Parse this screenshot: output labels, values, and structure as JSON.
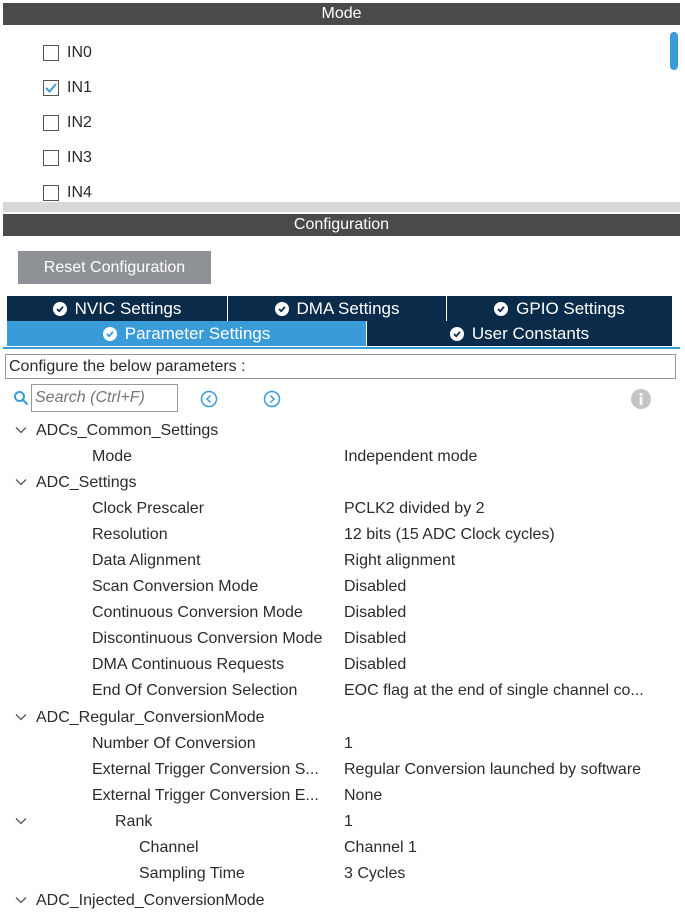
{
  "mode": {
    "header": "Mode",
    "items": [
      {
        "label": "IN0",
        "checked": false
      },
      {
        "label": "IN1",
        "checked": true
      },
      {
        "label": "IN2",
        "checked": false
      },
      {
        "label": "IN3",
        "checked": false
      },
      {
        "label": "IN4",
        "checked": false
      }
    ]
  },
  "configuration": {
    "header": "Configuration",
    "reset_label": "Reset Configuration",
    "tabs": [
      {
        "label": "NVIC Settings",
        "active": false
      },
      {
        "label": "DMA Settings",
        "active": false
      },
      {
        "label": "GPIO Settings",
        "active": false
      },
      {
        "label": "Parameter Settings",
        "active": true
      },
      {
        "label": "User Constants",
        "active": false
      }
    ],
    "configure_text": "Configure the below parameters :",
    "search_placeholder": "Search (Ctrl+F)"
  },
  "tree": {
    "groups": [
      {
        "name": "ADCs_Common_Settings",
        "params": [
          {
            "label": "Mode",
            "value": "Independent mode"
          }
        ]
      },
      {
        "name": "ADC_Settings",
        "params": [
          {
            "label": "Clock Prescaler",
            "value": "PCLK2 divided by 2"
          },
          {
            "label": "Resolution",
            "value": "12 bits (15 ADC Clock cycles)"
          },
          {
            "label": "Data Alignment",
            "value": "Right alignment"
          },
          {
            "label": "Scan Conversion Mode",
            "value": "Disabled"
          },
          {
            "label": "Continuous Conversion Mode",
            "value": "Disabled"
          },
          {
            "label": "Discontinuous Conversion Mode",
            "value": "Disabled"
          },
          {
            "label": "DMA Continuous Requests",
            "value": "Disabled"
          },
          {
            "label": "End Of Conversion Selection",
            "value": "EOC flag at the end of single channel co..."
          }
        ]
      },
      {
        "name": "ADC_Regular_ConversionMode",
        "params": [
          {
            "label": "Number Of Conversion",
            "value": "1"
          },
          {
            "label": "External Trigger Conversion S...",
            "value": "Regular Conversion launched by software"
          },
          {
            "label": "External Trigger Conversion E...",
            "value": "None"
          },
          {
            "label": "Rank",
            "value": "1"
          },
          {
            "label": "Channel",
            "value": "Channel 1"
          },
          {
            "label": "Sampling Time",
            "value": "3 Cycles"
          }
        ]
      },
      {
        "name": "ADC_Injected_ConversionMode",
        "params": []
      }
    ]
  },
  "colors": {
    "header_bg": "#4a4a4a",
    "tab_bg": "#0b2b4a",
    "tab_active_bg": "#3a9bd9",
    "accent": "#3a9bd9",
    "button_bg": "#8e9297"
  }
}
